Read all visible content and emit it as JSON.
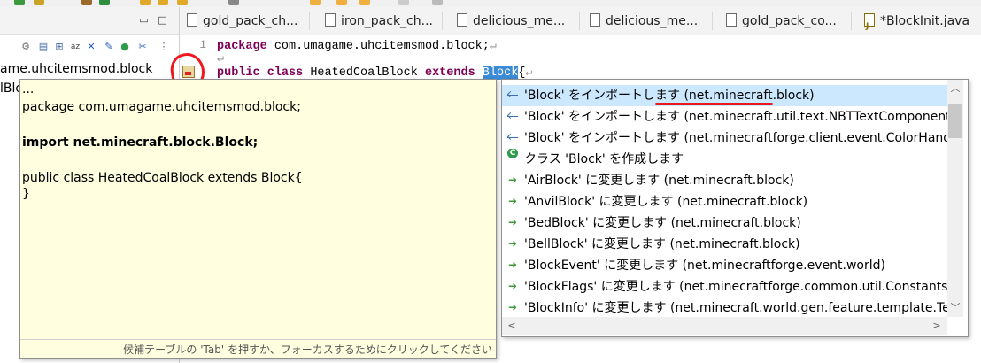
{
  "window": {
    "minimize": "▭",
    "maximize": "□"
  },
  "package_tree": {
    "item_package": "ame.uhcitemsmod.block",
    "item_file": "lBlo"
  },
  "tabs": [
    {
      "label": "gold_pack_ch...",
      "icon": "file-icon"
    },
    {
      "label": "iron_pack_ch...",
      "icon": "file-icon"
    },
    {
      "label": "delicious_me...",
      "icon": "file-icon"
    },
    {
      "label": "delicious_me...",
      "icon": "file-icon"
    },
    {
      "label": "gold_pack_co...",
      "icon": "file-icon"
    },
    {
      "label": "*BlockInit.java",
      "icon": "java-file-icon"
    }
  ],
  "editor": {
    "line1_number": "1",
    "line1_keyword": "package",
    "line1_rest": " com.umagame.uhcitemsmod.block;",
    "line3_kw_public": "public",
    "line3_kw_class": "class",
    "line3_name": " HeatedCoalBlock ",
    "line3_kw_extends": "extends",
    "line3_selected": "Block",
    "line3_brace": "{",
    "pilcrow": "↵"
  },
  "preview": {
    "lines": [
      "...",
      "package com.umagame.uhcitemsmod.block;",
      "import net.minecraft.block.Block;",
      "public class HeatedCoalBlock extends Block{",
      "}"
    ],
    "status": "候補テーブルの 'Tab' を押すか、フォーカスするためにクリックしてください"
  },
  "proposals": [
    {
      "icon": "import",
      "text": "'Block' をインポートします (net.minecraft.block)"
    },
    {
      "icon": "import",
      "text": "'Block' をインポートします (net.minecraft.util.text.NBTTextComponent)"
    },
    {
      "icon": "import",
      "text": "'Block' をインポートします (net.minecraftforge.client.event.ColorHandlerEvent)"
    },
    {
      "icon": "create",
      "text": "クラス 'Block' を作成します"
    },
    {
      "icon": "change",
      "text": "'AirBlock' に変更します (net.minecraft.block)"
    },
    {
      "icon": "change",
      "text": "'AnvilBlock' に変更します (net.minecraft.block)"
    },
    {
      "icon": "change",
      "text": "'BedBlock' に変更します (net.minecraft.block)"
    },
    {
      "icon": "change",
      "text": "'BellBlock' に変更します (net.minecraft.block)"
    },
    {
      "icon": "change",
      "text": "'BlockEvent' に変更します (net.minecraftforge.event.world)"
    },
    {
      "icon": "change",
      "text": "'BlockFlags' に変更します (net.minecraftforge.common.util.Constants)"
    },
    {
      "icon": "change",
      "text": "'BlockInfo' に変更します (net.minecraft.world.gen.feature.template.Templat"
    }
  ],
  "colors": {
    "keyword": "#7f0055",
    "selection": "#3b8bd6",
    "annotation_red": "#f0181e",
    "preview_bg": "#ffffe0",
    "proposal_selected": "#cce8ff"
  }
}
